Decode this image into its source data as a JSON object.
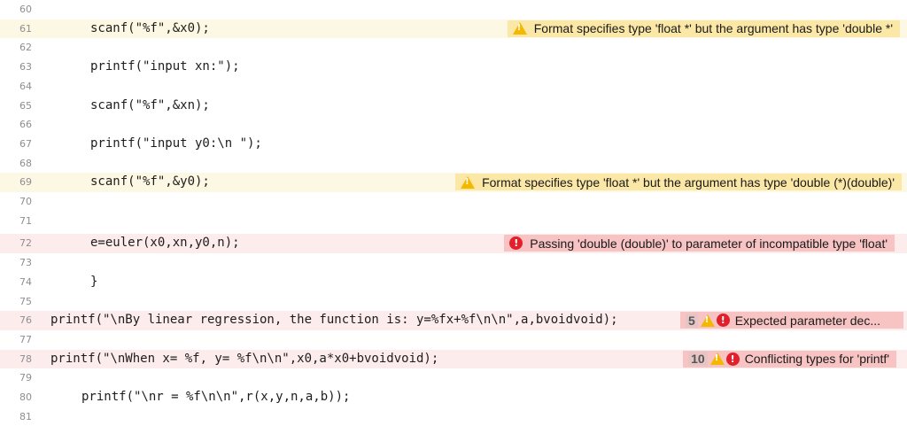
{
  "lines": [
    {
      "num": "60"
    },
    {
      "num": "61",
      "code": "scanf(\"%f\",&x0);"
    },
    {
      "num": "62"
    },
    {
      "num": "63",
      "code": "printf(\"input xn:\");"
    },
    {
      "num": "64"
    },
    {
      "num": "65",
      "code": "scanf(\"%f\",&xn);"
    },
    {
      "num": "66"
    },
    {
      "num": "67",
      "code": "printf(\"input y0:\\n \");"
    },
    {
      "num": "68"
    },
    {
      "num": "69",
      "code": "scanf(\"%f\",&y0);"
    },
    {
      "num": "70"
    },
    {
      "num": "71"
    },
    {
      "num": "72",
      "code": "e=euler(x0,xn,y0,n);"
    },
    {
      "num": "73"
    },
    {
      "num": "74",
      "code": "}"
    },
    {
      "num": "75"
    },
    {
      "num": "76",
      "code": "printf(\"\\nBy linear regression, the function is: y=%fx+%f\\n\\n\",a,bvoidvoid);"
    },
    {
      "num": "77"
    },
    {
      "num": "78",
      "code": "printf(\"\\nWhen x= %f, y= %f\\n\\n\",x0,a*x0+bvoidvoid);"
    },
    {
      "num": "79"
    },
    {
      "num": "80",
      "code": "printf(\"\\nr = %f\\n\\n\",r(x,y,n,a,b));"
    },
    {
      "num": "81"
    }
  ],
  "issues": {
    "l61": {
      "text": "Format specifies type 'float *' but the argument has type 'double *'"
    },
    "l69": {
      "text": "Format specifies type 'float *' but the argument has type 'double (*)(double)'"
    },
    "l72": {
      "text": "Passing 'double (double)' to parameter of incompatible type 'float'"
    },
    "l76": {
      "count": "5",
      "text": "Expected parameter dec..."
    },
    "l78": {
      "count": "10",
      "text": "Conflicting types for 'printf'"
    }
  },
  "colors": {
    "warning_line": "#fdf8e3",
    "error_line": "#fdecec",
    "warning_badge": "#fbe7a6",
    "error_badge": "#f7c3c3",
    "string": "#c41a16",
    "function": "#3f2fa8"
  }
}
